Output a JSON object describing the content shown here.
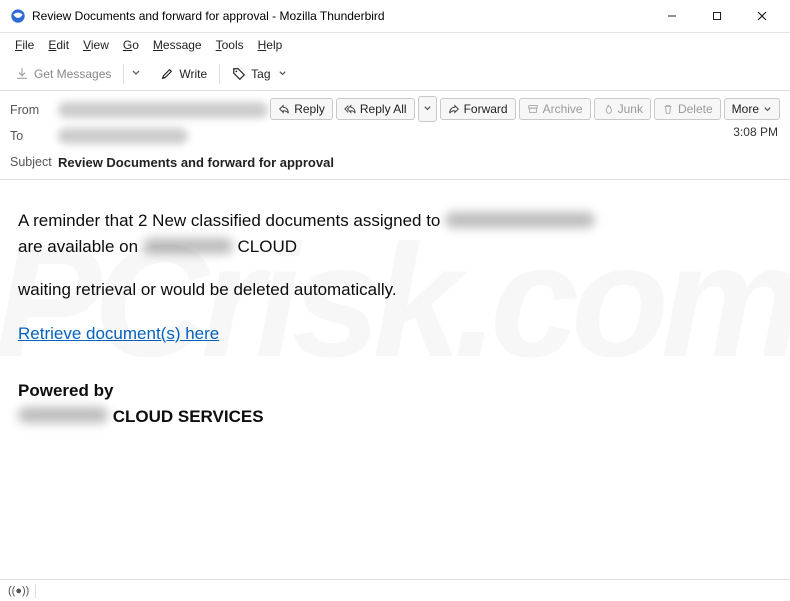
{
  "window": {
    "title": "Review Documents and forward for approval - Mozilla Thunderbird",
    "minimize_aria": "Minimize",
    "maximize_aria": "Maximize",
    "close_aria": "Close"
  },
  "menubar": {
    "file": "File",
    "edit": "Edit",
    "view": "View",
    "go": "Go",
    "message": "Message",
    "tools": "Tools",
    "help": "Help"
  },
  "toolbar": {
    "get_messages": "Get Messages",
    "write": "Write",
    "tag": "Tag"
  },
  "actions": {
    "reply": "Reply",
    "reply_all": "Reply All",
    "forward": "Forward",
    "archive": "Archive",
    "junk": "Junk",
    "delete": "Delete",
    "more": "More"
  },
  "headers": {
    "from_label": "From",
    "to_label": "To",
    "subject_label": "Subject",
    "subject_value": "Review Documents and forward for approval",
    "timestamp": "3:08 PM"
  },
  "body": {
    "line1_a": "A reminder that 2 New classified documents assigned to ",
    "line1_b": "are available on ",
    "line1_c": " CLOUD",
    "line2": "waiting retrieval or would be deleted automatically.",
    "link": "Retrieve document(s) here",
    "powered_by": "Powered by",
    "services": " CLOUD SERVICES"
  },
  "watermark": "PCrisk.com"
}
